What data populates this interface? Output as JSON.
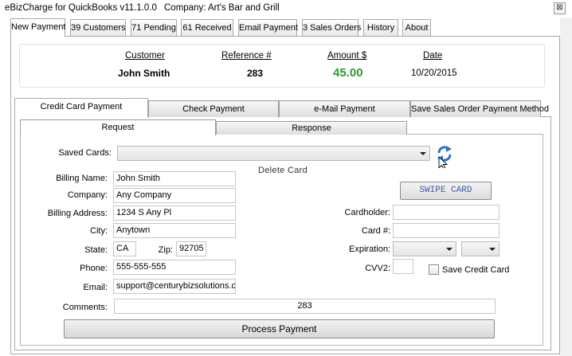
{
  "window": {
    "app_title": "eBizCharge for QuickBooks v11.1.0.0",
    "company": "Company: Art's Bar and Grill",
    "close_glyph": "⊠"
  },
  "main_tabs": [
    {
      "label": "New Payment",
      "active": true
    },
    {
      "label": "39 Customers"
    },
    {
      "label": "71 Pending"
    },
    {
      "label": "61 Received"
    },
    {
      "label": "Email Payment"
    },
    {
      "label": "3 Sales Orders"
    },
    {
      "label": "History"
    },
    {
      "label": "About"
    }
  ],
  "summary": {
    "customer_header": "Customer",
    "customer_value": "John Smith",
    "reference_header": "Reference #",
    "reference_value": "283",
    "amount_header": "Amount $",
    "amount_value": "45.00",
    "date_header": "Date",
    "date_value": "10/20/2015",
    "amount_color": "#2e9a2e"
  },
  "payment_tabs": [
    {
      "label": "Credit Card Payment",
      "active": true
    },
    {
      "label": "Check Payment"
    },
    {
      "label": "e-Mail Payment"
    },
    {
      "label": "Save Sales Order Payment Method"
    }
  ],
  "sub_tabs": [
    {
      "label": "Request",
      "active": true
    },
    {
      "label": "Response"
    }
  ],
  "form": {
    "saved_cards_label": "Saved Cards:",
    "saved_cards_value": "",
    "delete_card": "Delete Card",
    "billing_name_label": "Billing Name:",
    "billing_name": "John Smith",
    "company_label": "Company:",
    "company": "Any Company",
    "address_label": "Billing Address:",
    "address": "1234 S Any Pl",
    "city_label": "City:",
    "city": "Anytown",
    "state_label": "State:",
    "state": "CA",
    "zip_label": "Zip:",
    "zip": "92705",
    "phone_label": "Phone:",
    "phone": "555-555-555",
    "email_label": "Email:",
    "email": "support@centurybizsolutions.com",
    "comments_label": "Comments:",
    "comments": "283",
    "swipe_card": "SWIPE CARD",
    "cardholder_label": "Cardholder:",
    "cardholder": "",
    "card_number_label": "Card #:",
    "card_number": "",
    "expiration_label": "Expiration:",
    "exp_month": "",
    "exp_year": "",
    "cvv2_label": "CVV2:",
    "cvv2": "",
    "save_card_label": "Save Credit Card",
    "save_card_checked": false,
    "process_payment": "Process Payment"
  },
  "icons": {
    "refresh": "refresh-icon",
    "cursor": "mouse-cursor-icon"
  }
}
